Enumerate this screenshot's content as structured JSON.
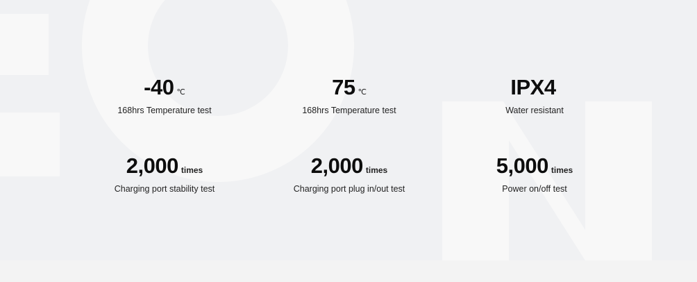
{
  "stats": [
    {
      "value": "-40",
      "unit": "℃",
      "label": "168hrs Temperature test"
    },
    {
      "value": "75",
      "unit": "℃",
      "label": "168hrs Temperature test"
    },
    {
      "value": "IPX4",
      "unit": "",
      "label": "Water resistant"
    },
    {
      "value": "2,000",
      "unit": "times",
      "label": "Charging port stability test"
    },
    {
      "value": "2,000",
      "unit": "times",
      "label": "Charging port plug in/out test"
    },
    {
      "value": "5,000",
      "unit": "times",
      "label": "Power on/off test"
    }
  ]
}
